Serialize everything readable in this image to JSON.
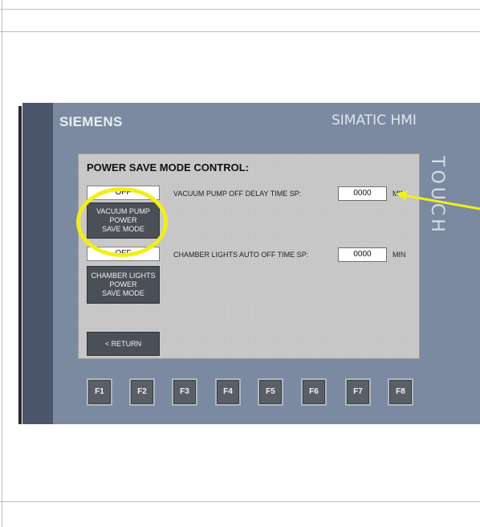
{
  "hmi": {
    "brand": "SIEMENS",
    "product": "SIMATIC HMI",
    "touch_label": "TOUCH"
  },
  "screen": {
    "title": "POWER SAVE MODE CONTROL:",
    "vacuum": {
      "status": "OFF",
      "button_lines": [
        "VACUUM PUMP",
        "POWER",
        "SAVE MODE"
      ],
      "delay_label": "VACUUM PUMP OFF DELAY TIME SP:",
      "delay_value": "0000",
      "delay_unit": "MIN"
    },
    "chamber": {
      "status": "OFF",
      "button_lines": [
        "CHAMBER LIGHTS",
        "POWER",
        "SAVE MODE"
      ],
      "delay_label": "CHAMBER LIGHTS AUTO OFF TIME SP:",
      "delay_value": "0000",
      "delay_unit": "MIN"
    },
    "return_label": "< RETURN"
  },
  "function_keys": [
    "F1",
    "F2",
    "F3",
    "F4",
    "F5",
    "F6",
    "F7",
    "F8"
  ],
  "annotation_colors": {
    "highlight": "#f2ee1a"
  }
}
